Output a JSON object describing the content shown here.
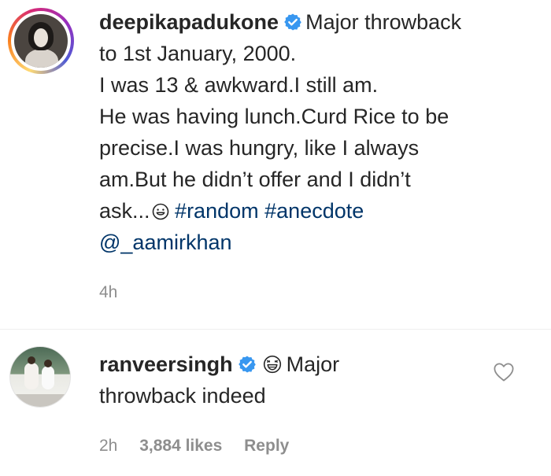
{
  "post": {
    "username": "deepikapadukone",
    "caption_lines": [
      "Major throwback",
      "to 1st January, 2000.",
      "I was 13 & awkward.I still am.",
      "He was having lunch.Curd Rice to be",
      "precise.I was hungry, like I always",
      "am.But he didn’t offer and I didn’t",
      "ask..."
    ],
    "hashtags": [
      "#random",
      "#anecdote"
    ],
    "mention": "@_aamirkhan",
    "time": "4h"
  },
  "comment": {
    "username": "ranveersingh",
    "text_line1": "Major",
    "text_line2": "throwback indeed",
    "time": "2h",
    "likes": "3,884 likes",
    "reply_label": "Reply"
  },
  "icons": {
    "verified": "verified-badge-icon",
    "smile": "smile-emoji-icon",
    "laugh": "laughing-emoji-icon",
    "heart": "heart-outline-icon"
  },
  "colors": {
    "text": "#262626",
    "muted": "#8e8e8e",
    "link": "#003569",
    "verified": "#3897f0"
  }
}
